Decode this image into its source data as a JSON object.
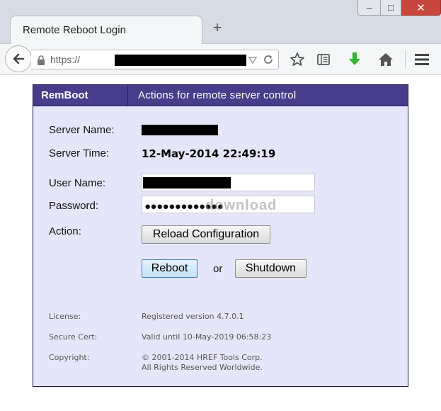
{
  "browser": {
    "tab_title": "Remote Reboot Login",
    "new_tab_glyph": "+",
    "url_prefix": "https://",
    "window_controls": {
      "minimize": "–",
      "maximize": "□",
      "close": "✕"
    }
  },
  "page": {
    "brand": "RemBoot",
    "header_subtitle": "Actions for remote server control",
    "server_name_label": "Server Name:",
    "server_time_label": "Server Time:",
    "server_time_value": "12-May-2014 22:49:19",
    "user_name_label": "User Name:",
    "password_label": "Password:",
    "password_dots": "●●●●●●●●●●●●●",
    "watermark": "download",
    "action_label": "Action:",
    "reload_button": "Reload Configuration",
    "reboot_button": "Reboot",
    "or_text": "or",
    "shutdown_button": "Shutdown",
    "license_label": "License:",
    "license_value": "Registered version 4.7.0.1",
    "cert_label": "Secure Cert:",
    "cert_value": "Valid until 10-May-2019 06:58:23",
    "copyright_label": "Copyright:",
    "copyright_line1": "© 2001-2014 HREF Tools Corp.",
    "copyright_line2": "All Rights Reserved Worldwide."
  },
  "icons": {
    "back": "back-arrow-icon",
    "lock": "lock-icon",
    "bookmark": "star-icon",
    "reading": "reading-list-icon",
    "download": "download-arrow-icon",
    "home": "home-icon",
    "menu": "hamburger-menu-icon"
  },
  "colors": {
    "header_bg": "#483d8b",
    "panel_bg": "#e6e6fa",
    "download_green": "#2eb82e"
  }
}
